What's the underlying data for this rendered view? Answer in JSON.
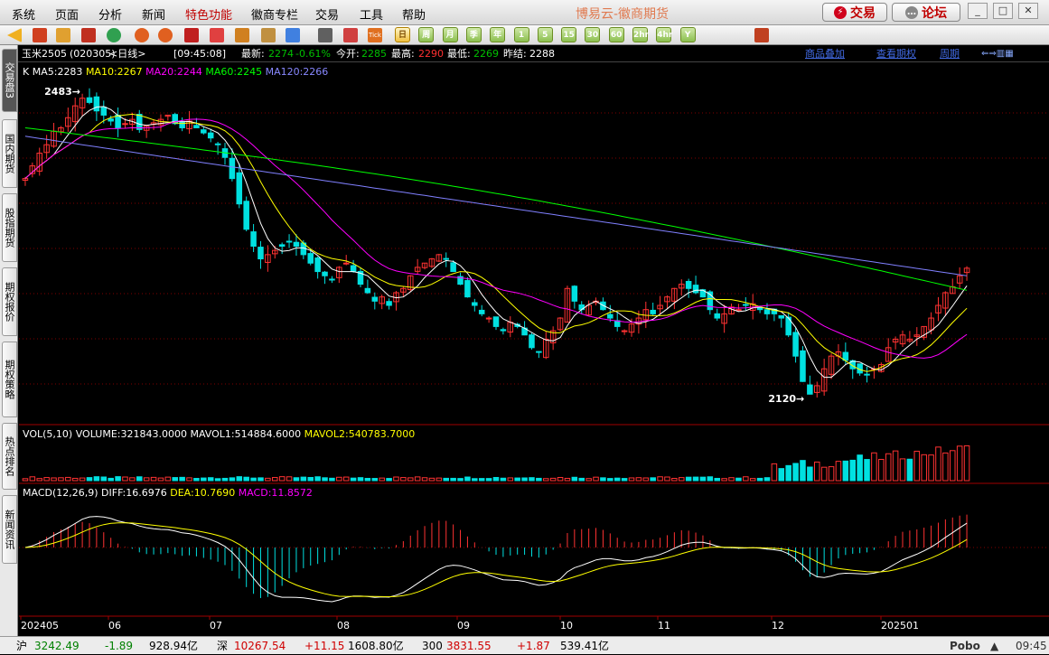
{
  "menu": {
    "items": [
      "系统",
      "页面",
      "分析",
      "新闻",
      "特色功能",
      "徽商专栏",
      "交易",
      "工具",
      "帮助"
    ],
    "brand": "博易云-徽商期货",
    "trade_button": "交易",
    "forum_button": "论坛"
  },
  "toolbar": {
    "periods": [
      "日",
      "周",
      "月",
      "季",
      "年",
      "1",
      "5",
      "15",
      "30",
      "60",
      "2hr",
      "4hr",
      "Y"
    ],
    "active_period": "日"
  },
  "sidebar": {
    "tabs": [
      "交易盘3",
      "国内期货",
      "股指期货",
      "期权报价",
      "期权策略",
      "热点排名",
      "新闻资讯"
    ]
  },
  "info": {
    "symbol": "玉米2505",
    "code": "(020305)",
    "period": "<日线>",
    "time": "[09:45:08]",
    "last_label": "最新:",
    "last_value": "2274",
    "change": "-0.61%",
    "open_label": "今开:",
    "open_value": "2285",
    "high_label": "最高:",
    "high_value": "2290",
    "low_label": "最低:",
    "low_value": "2269",
    "prev_label": "昨结:",
    "prev_value": "2288",
    "link1": "商品叠加",
    "link2": "查看期权",
    "link3": "周期"
  },
  "ma_legend": {
    "k": "K",
    "ma5": "MA5:2283",
    "ma10": "MA10:2267",
    "ma20": "MA20:2244",
    "ma60": "MA60:2245",
    "ma120": "MA120:2266"
  },
  "annotations": {
    "high": "2483",
    "low": "2120"
  },
  "vol_legend": {
    "name": "VOL(5,10)",
    "volume": "VOLUME:321843.0000",
    "mavol1": "MAVOL1:514884.6000",
    "mavol2": "MAVOL2:540783.7000"
  },
  "macd_legend": {
    "name": "MACD(12,26,9)",
    "diff": "DIFF:16.6976",
    "dea": "DEA:10.7690",
    "macd": "MACD:11.8572"
  },
  "x_labels": [
    "202405",
    "06",
    "07",
    "08",
    "09",
    "10",
    "11",
    "12",
    "202501"
  ],
  "status": {
    "sh_label": "沪",
    "sh_value": "3242.49",
    "sh_change": "-1.89",
    "sh_amount": "928.94亿",
    "sz_label": "深",
    "sz_value": "10267.54",
    "sz_change": "+11.15",
    "sz_amount": "1608.80亿",
    "hs_label": "300",
    "hs_value": "3831.55",
    "hs_change": "+1.87",
    "hs_amount": "539.41亿",
    "app": "Pobo",
    "clock": "09:45"
  },
  "colors": {
    "up": "#ff3232",
    "down": "#00e0e0",
    "ma5": "#ffffff",
    "ma10": "#ffff00",
    "ma20": "#ff00ff",
    "ma60": "#00ff00",
    "ma120": "#8080ff"
  },
  "chart_data": {
    "type": "candlestick",
    "closes": [
      2380,
      2395,
      2410,
      2420,
      2436,
      2440,
      2452,
      2466,
      2475,
      2470,
      2460,
      2455,
      2448,
      2440,
      2445,
      2450,
      2438,
      2442,
      2446,
      2450,
      2455,
      2445,
      2440,
      2448,
      2440,
      2434,
      2428,
      2420,
      2405,
      2380,
      2350,
      2320,
      2300,
      2285,
      2290,
      2295,
      2300,
      2305,
      2300,
      2290,
      2280,
      2270,
      2265,
      2260,
      2275,
      2280,
      2270,
      2255,
      2245,
      2235,
      2240,
      2230,
      2245,
      2250,
      2265,
      2275,
      2280,
      2285,
      2290,
      2285,
      2270,
      2255,
      2240,
      2230,
      2220,
      2215,
      2205,
      2200,
      2210,
      2205,
      2195,
      2180,
      2175,
      2190,
      2200,
      2215,
      2250,
      2235,
      2225,
      2230,
      2235,
      2225,
      2215,
      2205,
      2200,
      2208,
      2215,
      2225,
      2220,
      2230,
      2240,
      2250,
      2255,
      2250,
      2245,
      2240,
      2225,
      2215,
      2220,
      2228,
      2225,
      2230,
      2232,
      2225,
      2220,
      2220,
      2215,
      2195,
      2170,
      2140,
      2125,
      2135,
      2155,
      2170,
      2175,
      2165,
      2155,
      2150,
      2148,
      2155,
      2160,
      2180,
      2190,
      2195,
      2190,
      2195,
      2205,
      2215,
      2230,
      2245,
      2252,
      2265,
      2274
    ],
    "volume": {
      "last": 321843,
      "mavol1": 514884.6,
      "mavol2": 540783.7
    },
    "macd": {
      "diff": 16.6976,
      "dea": 10.769,
      "macd": 11.8572
    },
    "high": 2483,
    "low": 2120,
    "ma": {
      "ma5": 2283,
      "ma10": 2267,
      "ma20": 2244,
      "ma60": 2245,
      "ma120": 2266
    }
  }
}
